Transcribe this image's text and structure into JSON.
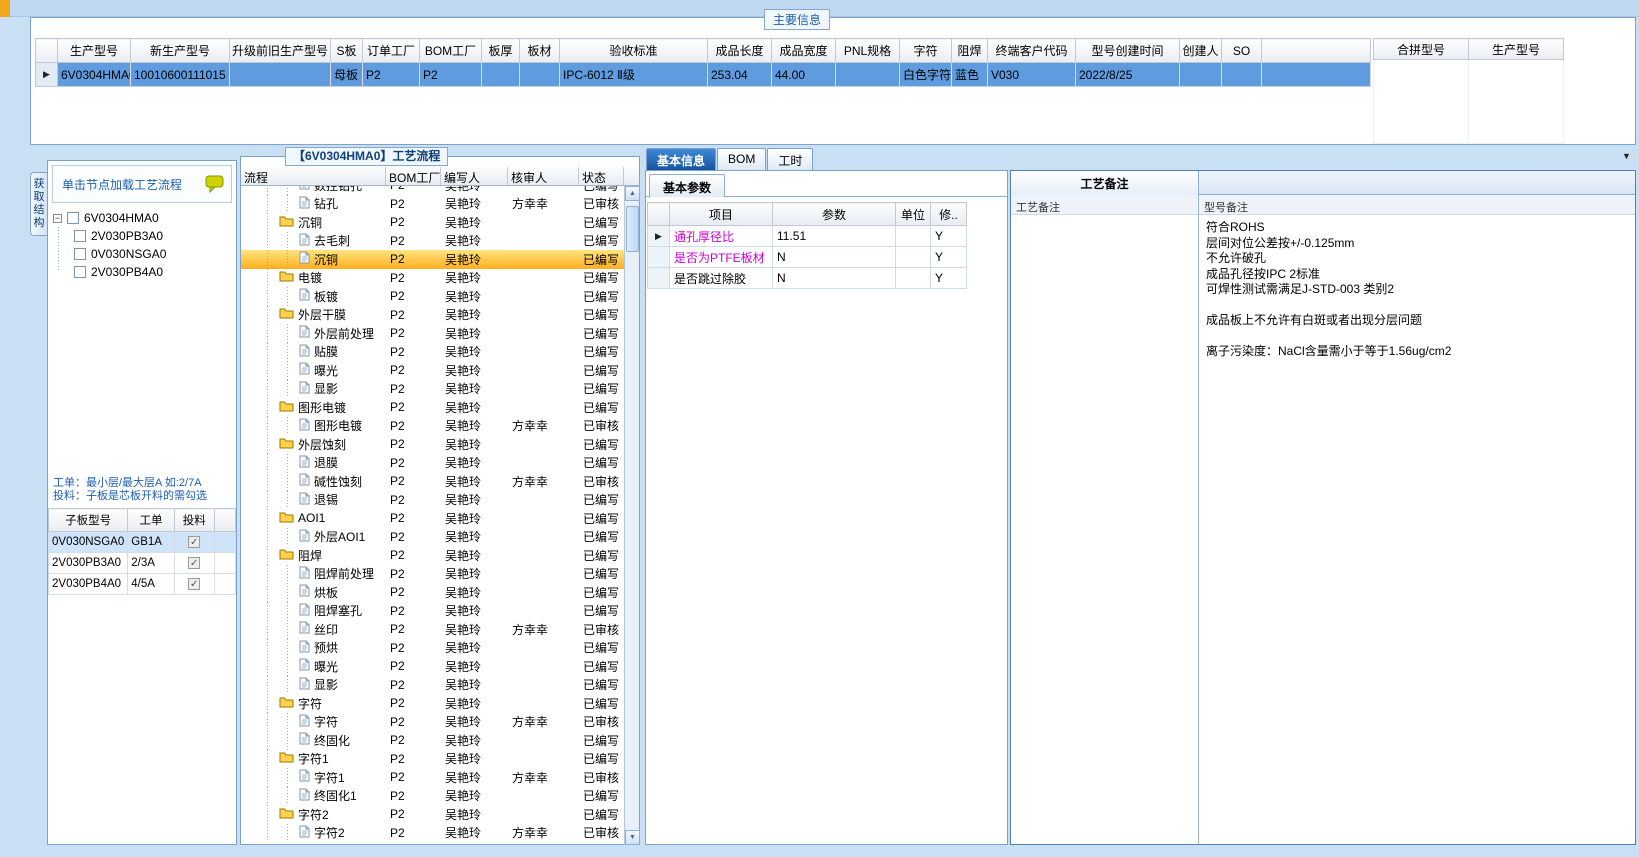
{
  "top_title": "主要信息",
  "main_table": {
    "columns": [
      "生产型号",
      "新生产型号",
      "升级前旧生产型号",
      "S板",
      "订单工厂",
      "BOM工厂",
      "板厚",
      "板材",
      "验收标准",
      "成品长度",
      "成品宽度",
      "PNL规格",
      "字符",
      "阻焊",
      "终端客户代码",
      "型号创建时间",
      "创建人",
      "SO",
      ""
    ],
    "row": [
      "6V0304HMA0",
      "10010600111015",
      "",
      "母板",
      "P2",
      "P2",
      "",
      "",
      "IPC-6012 Ⅱ级",
      "253.04",
      "44.00",
      "",
      "白色字符",
      "蓝色",
      "V030",
      "2022/8/25",
      "",
      "",
      ""
    ]
  },
  "side_table": {
    "columns": [
      "合拼型号",
      "生产型号"
    ]
  },
  "left_panel": {
    "vertical_tab": "获取结构",
    "hint": "单击节点加载工艺流程",
    "tree": {
      "root": "6V0304HMA0",
      "children": [
        "2V030PB3A0",
        "0V030NSGA0",
        "2V030PB4A0"
      ]
    },
    "notes": [
      "工单：最小层/最大层A 如:2/7A",
      "投料：子板是芯板开料的需勾选"
    ],
    "sub_table": {
      "columns": [
        "子板型号",
        "工单",
        "投料"
      ],
      "rows": [
        {
          "model": "0V030NSGA0",
          "order": "GB1A",
          "checked": true,
          "selected": true
        },
        {
          "model": "2V030PB3A0",
          "order": "2/3A",
          "checked": true,
          "selected": false
        },
        {
          "model": "2V030PB4A0",
          "order": "4/5A",
          "checked": true,
          "selected": false
        }
      ]
    }
  },
  "process": {
    "title": "【6V0304HMA0】工艺流程",
    "columns": [
      "流程",
      "BOM工厂",
      "编写人",
      "核审人",
      "状态"
    ],
    "rows": [
      {
        "t": "file",
        "n": "数控钻孔",
        "b": "P2",
        "w": "吴艳玲",
        "r": "",
        "s": "已编写",
        "clip": true
      },
      {
        "t": "file",
        "n": "钻孔",
        "b": "P2",
        "w": "吴艳玲",
        "r": "方幸幸",
        "s": "已审核"
      },
      {
        "t": "folder",
        "n": "沉铜",
        "b": "P2",
        "w": "吴艳玲",
        "r": "",
        "s": "已编写"
      },
      {
        "t": "file",
        "n": "去毛刺",
        "b": "P2",
        "w": "吴艳玲",
        "r": "",
        "s": "已编写"
      },
      {
        "t": "file",
        "n": "沉铜",
        "b": "P2",
        "w": "吴艳玲",
        "r": "",
        "s": "已编写",
        "sel": true
      },
      {
        "t": "folder",
        "n": "电镀",
        "b": "P2",
        "w": "吴艳玲",
        "r": "",
        "s": "已编写"
      },
      {
        "t": "file",
        "n": "板镀",
        "b": "P2",
        "w": "吴艳玲",
        "r": "",
        "s": "已编写"
      },
      {
        "t": "folder",
        "n": "外层干膜",
        "b": "P2",
        "w": "吴艳玲",
        "r": "",
        "s": "已编写"
      },
      {
        "t": "file",
        "n": "外层前处理",
        "b": "P2",
        "w": "吴艳玲",
        "r": "",
        "s": "已编写"
      },
      {
        "t": "file",
        "n": "贴膜",
        "b": "P2",
        "w": "吴艳玲",
        "r": "",
        "s": "已编写"
      },
      {
        "t": "file",
        "n": "曝光",
        "b": "P2",
        "w": "吴艳玲",
        "r": "",
        "s": "已编写"
      },
      {
        "t": "file",
        "n": "显影",
        "b": "P2",
        "w": "吴艳玲",
        "r": "",
        "s": "已编写"
      },
      {
        "t": "folder",
        "n": "图形电镀",
        "b": "P2",
        "w": "吴艳玲",
        "r": "",
        "s": "已编写"
      },
      {
        "t": "file",
        "n": "图形电镀",
        "b": "P2",
        "w": "吴艳玲",
        "r": "方幸幸",
        "s": "已审核"
      },
      {
        "t": "folder",
        "n": "外层蚀刻",
        "b": "P2",
        "w": "吴艳玲",
        "r": "",
        "s": "已编写"
      },
      {
        "t": "file",
        "n": "退膜",
        "b": "P2",
        "w": "吴艳玲",
        "r": "",
        "s": "已编写"
      },
      {
        "t": "file",
        "n": "碱性蚀刻",
        "b": "P2",
        "w": "吴艳玲",
        "r": "方幸幸",
        "s": "已审核"
      },
      {
        "t": "file",
        "n": "退锡",
        "b": "P2",
        "w": "吴艳玲",
        "r": "",
        "s": "已编写"
      },
      {
        "t": "folder",
        "n": "AOI1",
        "b": "P2",
        "w": "吴艳玲",
        "r": "",
        "s": "已编写"
      },
      {
        "t": "file",
        "n": "外层AOI1",
        "b": "P2",
        "w": "吴艳玲",
        "r": "",
        "s": "已编写"
      },
      {
        "t": "folder",
        "n": "阻焊",
        "b": "P2",
        "w": "吴艳玲",
        "r": "",
        "s": "已编写"
      },
      {
        "t": "file",
        "n": "阻焊前处理",
        "b": "P2",
        "w": "吴艳玲",
        "r": "",
        "s": "已编写"
      },
      {
        "t": "file",
        "n": "烘板",
        "b": "P2",
        "w": "吴艳玲",
        "r": "",
        "s": "已编写"
      },
      {
        "t": "file",
        "n": "阻焊塞孔",
        "b": "P2",
        "w": "吴艳玲",
        "r": "",
        "s": "已编写"
      },
      {
        "t": "file",
        "n": "丝印",
        "b": "P2",
        "w": "吴艳玲",
        "r": "方幸幸",
        "s": "已审核"
      },
      {
        "t": "file",
        "n": "预烘",
        "b": "P2",
        "w": "吴艳玲",
        "r": "",
        "s": "已编写"
      },
      {
        "t": "file",
        "n": "曝光",
        "b": "P2",
        "w": "吴艳玲",
        "r": "",
        "s": "已编写"
      },
      {
        "t": "file",
        "n": "显影",
        "b": "P2",
        "w": "吴艳玲",
        "r": "",
        "s": "已编写"
      },
      {
        "t": "folder",
        "n": "字符",
        "b": "P2",
        "w": "吴艳玲",
        "r": "",
        "s": "已编写"
      },
      {
        "t": "file",
        "n": "字符",
        "b": "P2",
        "w": "吴艳玲",
        "r": "方幸幸",
        "s": "已审核"
      },
      {
        "t": "file",
        "n": "终固化",
        "b": "P2",
        "w": "吴艳玲",
        "r": "",
        "s": "已编写"
      },
      {
        "t": "folder",
        "n": "字符1",
        "b": "P2",
        "w": "吴艳玲",
        "r": "",
        "s": "已编写"
      },
      {
        "t": "file",
        "n": "字符1",
        "b": "P2",
        "w": "吴艳玲",
        "r": "方幸幸",
        "s": "已审核"
      },
      {
        "t": "file",
        "n": "终固化1",
        "b": "P2",
        "w": "吴艳玲",
        "r": "",
        "s": "已编写"
      },
      {
        "t": "folder",
        "n": "字符2",
        "b": "P2",
        "w": "吴艳玲",
        "r": "",
        "s": "已编写"
      },
      {
        "t": "file",
        "n": "字符2",
        "b": "P2",
        "w": "吴艳玲",
        "r": "方幸幸",
        "s": "已审核"
      }
    ]
  },
  "right_panel": {
    "tabs": [
      "基本信息",
      "BOM",
      "工时"
    ],
    "active_tab": 0
  },
  "params": {
    "tab": "基本参数",
    "columns": [
      "项目",
      "参数",
      "单位",
      "修.."
    ],
    "rows": [
      {
        "item": "通孔厚径比",
        "value": "11.51",
        "unit": "",
        "mod": "Y",
        "highlight": true,
        "current": true
      },
      {
        "item": "是否为PTFE板材",
        "value": "N",
        "unit": "",
        "mod": "Y",
        "highlight": true,
        "current": false
      },
      {
        "item": "是否跳过除胶",
        "value": "N",
        "unit": "",
        "mod": "Y",
        "highlight": false,
        "current": false
      }
    ]
  },
  "notes": {
    "header": "工艺备注",
    "columns": [
      "工艺备注",
      "型号备注"
    ],
    "process_note": "",
    "model_note_lines": [
      "符合ROHS",
      "层间对位公差按+/-0.125mm",
      "不允许破孔",
      "成品孔径按IPC 2标准",
      "可焊性测试需满足J-STD-003 类别2",
      "",
      "成品板上不允许有白斑或者出现分层问题",
      "",
      "离子污染度：NaCl含量需小于等于1.56ug/cm2"
    ]
  },
  "colors": {
    "selected_row": "#5e9cdf",
    "process_selected": "#ffae1f",
    "accent_blue": "#1b5eab",
    "magenta_item": "#cf00cf"
  }
}
